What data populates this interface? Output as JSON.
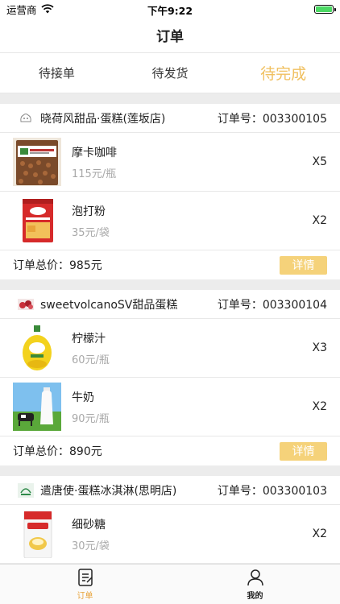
{
  "status_bar": {
    "carrier": "运营商",
    "time": "下午9:22"
  },
  "nav": {
    "title": "订单"
  },
  "tabs": [
    {
      "label": "待接单"
    },
    {
      "label": "待发货"
    },
    {
      "label": "待完成",
      "active": true
    }
  ],
  "orders": [
    {
      "shop_name": "晓荷风甜品·蛋糕(莲坂店)",
      "order_no": "订单号：003300105",
      "items": [
        {
          "name": "摩卡咖啡",
          "price": "115元/瓶",
          "qty": "X5",
          "icon": "coffee-jar-image"
        },
        {
          "name": "泡打粉",
          "price": "35元/袋",
          "qty": "X2",
          "icon": "baking-powder-image"
        }
      ],
      "total": "订单总价：985元",
      "detail_label": "详情"
    },
    {
      "shop_name": "sweetvolcanoSV甜品蛋糕",
      "order_no": "订单号：003300104",
      "items": [
        {
          "name": "柠檬汁",
          "price": "60元/瓶",
          "qty": "X3",
          "icon": "lemon-juice-image"
        },
        {
          "name": "牛奶",
          "price": "90元/瓶",
          "qty": "X2",
          "icon": "milk-image"
        }
      ],
      "total": "订单总价：890元",
      "detail_label": "详情"
    },
    {
      "shop_name": "遣唐使·蛋糕冰淇淋(思明店)",
      "order_no": "订单号：003300103",
      "items": [
        {
          "name": "细砂糖",
          "price": "30元/袋",
          "qty": "X2",
          "icon": "sugar-bag-image"
        }
      ]
    }
  ],
  "tabbar": [
    {
      "label": "订单",
      "icon": "order-list-icon",
      "active": true
    },
    {
      "label": "我的",
      "icon": "user-icon"
    }
  ],
  "colors": {
    "accent": "#f0c060",
    "button": "#f5d27a",
    "tabbar_active": "#e8a33a",
    "divider": "#ececec"
  }
}
